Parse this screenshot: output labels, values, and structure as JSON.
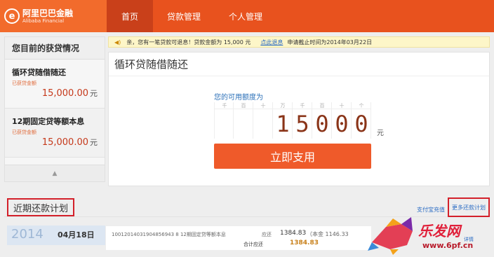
{
  "brand": {
    "logo_glyph": "e",
    "name_cn": "阿里巴巴金融",
    "name_en": "Alibaba Financial"
  },
  "nav": {
    "items": [
      {
        "label": "首页"
      },
      {
        "label": "贷款管理"
      },
      {
        "label": "个人管理"
      }
    ],
    "active_index": 0
  },
  "sidebar": {
    "title": "您目前的获贷情况",
    "loans": [
      {
        "name": "循环贷随借随还",
        "sub": "已获贷金额",
        "amount": "15,000.00",
        "unit": "元"
      },
      {
        "name": "12期固定贷等额本息",
        "sub": "已获贷金额",
        "amount": "15,000.00",
        "unit": "元"
      }
    ],
    "collapse_glyph": "▲"
  },
  "notice": {
    "text": "亲，您有一笔贷款可退息！贷款金额为 15,000 元",
    "link": "点此退息",
    "deadline": "申请截止时间为2014年03月22日"
  },
  "main": {
    "title": "循环贷随借随还",
    "available_label": "您的可用额度为",
    "places": [
      "千",
      "百",
      "十",
      "万",
      "千",
      "百",
      "十",
      "个"
    ],
    "digits": [
      "",
      "",
      "",
      "1",
      "5",
      "0",
      "0",
      "0"
    ],
    "unit": "元",
    "use_button": "立即支用"
  },
  "plan": {
    "title": "近期还款计划",
    "alipay_link": "支付宝充值",
    "more_link": "更多还款计划",
    "detail_link": "详情",
    "row": {
      "year": "2014",
      "date": "04月18日",
      "loan_id": "10012014031904856943 8 12期固定贷等额本息",
      "due_label": "应还",
      "due_amount": "1384.83",
      "principal": "（本金 1146.33",
      "total_label": "合计应还",
      "total_amount": "1384.83"
    }
  },
  "watermark": {
    "title": "乐发网",
    "url": "www.6pf.cn"
  },
  "colors": {
    "brand_orange": "#e8521e",
    "active_tab": "#c9401a",
    "amount_red": "#c5381a",
    "link_blue": "#2b6cc4",
    "highlight_red": "#d3202a"
  }
}
